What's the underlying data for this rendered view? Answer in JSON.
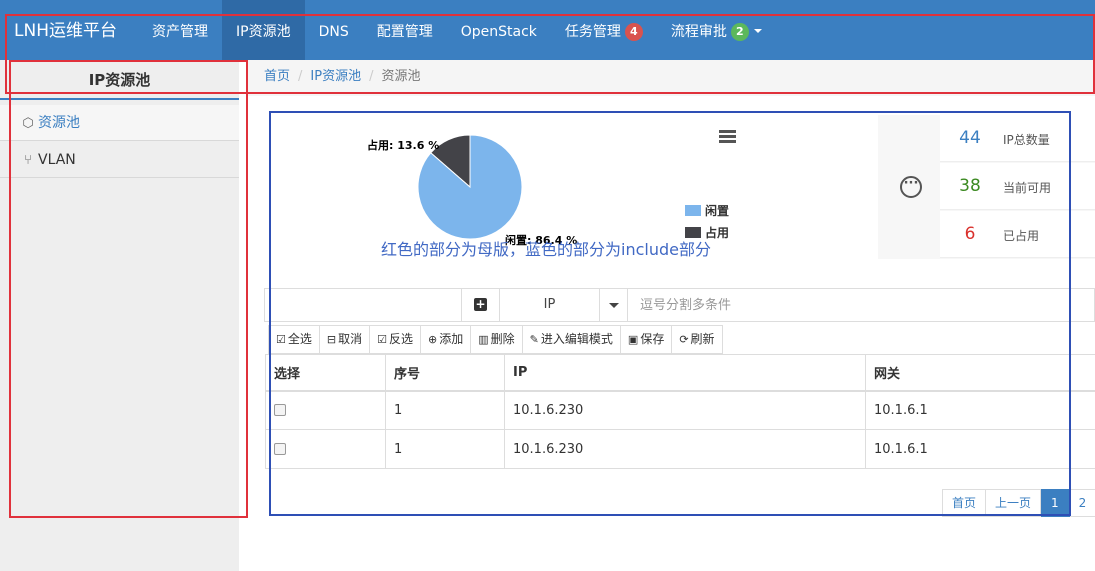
{
  "navbar": {
    "brand": "LNH运维平台",
    "items": [
      {
        "label": "资产管理"
      },
      {
        "label": "IP资源池"
      },
      {
        "label": "DNS"
      },
      {
        "label": "配置管理"
      },
      {
        "label": "OpenStack"
      },
      {
        "label": "任务管理",
        "badge": "4"
      },
      {
        "label": "流程审批",
        "badge": "2"
      }
    ]
  },
  "sidebar": {
    "title": "IP资源池",
    "items": [
      {
        "label": "资源池"
      },
      {
        "label": "VLAN"
      }
    ]
  },
  "breadcrumb": [
    "首页",
    "IP资源池",
    "资源池"
  ],
  "chart_data": {
    "type": "pie",
    "slices": [
      {
        "name": "闲置",
        "value": 86.4,
        "label": "闲置: 86.4 %",
        "color": "#7cb5ec"
      },
      {
        "name": "占用",
        "value": 13.6,
        "label": "占用: 13.6 %",
        "color": "#434348"
      }
    ],
    "legend": [
      "闲置",
      "占用"
    ],
    "legend_position": "right"
  },
  "stats": [
    {
      "value": "44",
      "label": "IP总数量",
      "color": "#3b7fc1"
    },
    {
      "value": "38",
      "label": "当前可用",
      "color": "#3c8a22"
    },
    {
      "value": "6",
      "label": "已占用",
      "color": "#d9302c"
    }
  ],
  "annotation": "红色的部分为母版，蓝色的部分为include部分",
  "search": {
    "field": "IP",
    "placeholder": "逗号分割多条件"
  },
  "toolbar": [
    {
      "label": "全选",
      "icon": "☑"
    },
    {
      "label": "取消",
      "icon": "⊟"
    },
    {
      "label": "反选",
      "icon": "☑"
    },
    {
      "label": "添加",
      "icon": "⊕"
    },
    {
      "label": "删除",
      "icon": "🗑"
    },
    {
      "label": "进入编辑模式",
      "icon": "✎"
    },
    {
      "label": "保存",
      "icon": "💾"
    },
    {
      "label": "刷新",
      "icon": "⟳"
    }
  ],
  "table": {
    "headers": [
      "选择",
      "序号",
      "IP",
      "网关"
    ],
    "rows": [
      [
        "",
        "1",
        "10.1.6.230",
        "10.1.6.1"
      ],
      [
        "",
        "1",
        "10.1.6.230",
        "10.1.6.1"
      ]
    ]
  },
  "pager": [
    "首页",
    "上一页",
    "1",
    "2"
  ]
}
